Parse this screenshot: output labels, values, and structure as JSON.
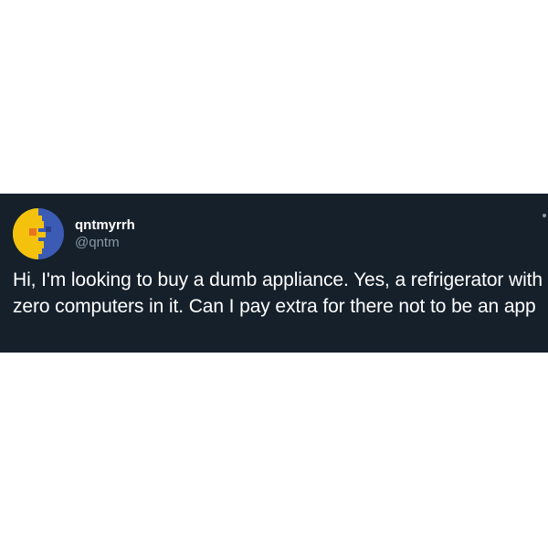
{
  "tweet": {
    "author": {
      "display_name": "qntmyrrh",
      "handle": "@qntm",
      "avatar_icon": "pixel-face-icon"
    },
    "text": "Hi, I'm looking to buy a dumb appliance. Yes, a refrigerator with zero computers in it. Can I pay extra for there not to be an app"
  },
  "colors": {
    "card_background": "#15202b",
    "text_primary": "#ffffff",
    "text_secondary": "#8899a6",
    "avatar_yellow": "#f4c20d",
    "avatar_blue": "#3b5bb5",
    "avatar_orange": "#e8761f"
  }
}
